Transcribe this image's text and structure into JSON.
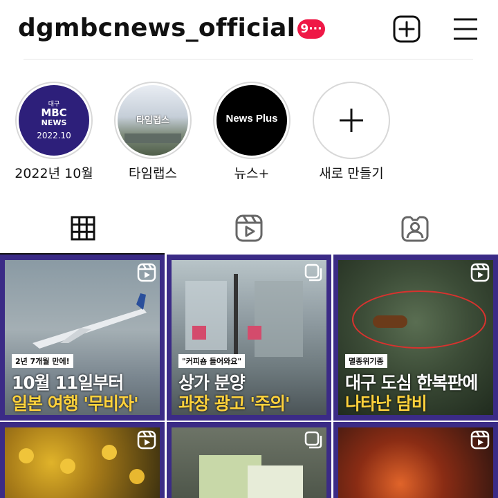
{
  "header": {
    "username": "dgmbcnews_official",
    "notification_badge": "9···"
  },
  "highlights": [
    {
      "label": "2022년 10월",
      "cover_text": [
        "대구",
        "MBC",
        "NEWS",
        "2022.10"
      ]
    },
    {
      "label": "타임랩스",
      "cover_text": "타임랩스"
    },
    {
      "label": "뉴스+",
      "cover_text": "News Plus"
    },
    {
      "label": "새로 만들기"
    }
  ],
  "tabs": [
    {
      "name": "grid",
      "icon": "grid-icon",
      "active": true
    },
    {
      "name": "reels",
      "icon": "reels-icon",
      "active": false
    },
    {
      "name": "tagged",
      "icon": "tagged-person-icon",
      "active": false
    }
  ],
  "posts": [
    {
      "type": "reel",
      "tag": "2년 7개월 만에!",
      "line1": "10월 11일부터",
      "line2": "일본 여행 '무비자'"
    },
    {
      "type": "carousel",
      "tag": "\"커피숍 들어와요\"",
      "line1": "상가 분양",
      "line2": "과장 광고 '주의'"
    },
    {
      "type": "reel",
      "tag": "멸종위기종",
      "line1": "대구 도심 한복판에",
      "line2": "나타난 담비"
    },
    {
      "type": "reel"
    },
    {
      "type": "carousel"
    },
    {
      "type": "reel"
    }
  ],
  "colors": {
    "badge": "#ef1846",
    "tile_border": "#3b2b86",
    "highlight_text": "#ffd23c"
  }
}
